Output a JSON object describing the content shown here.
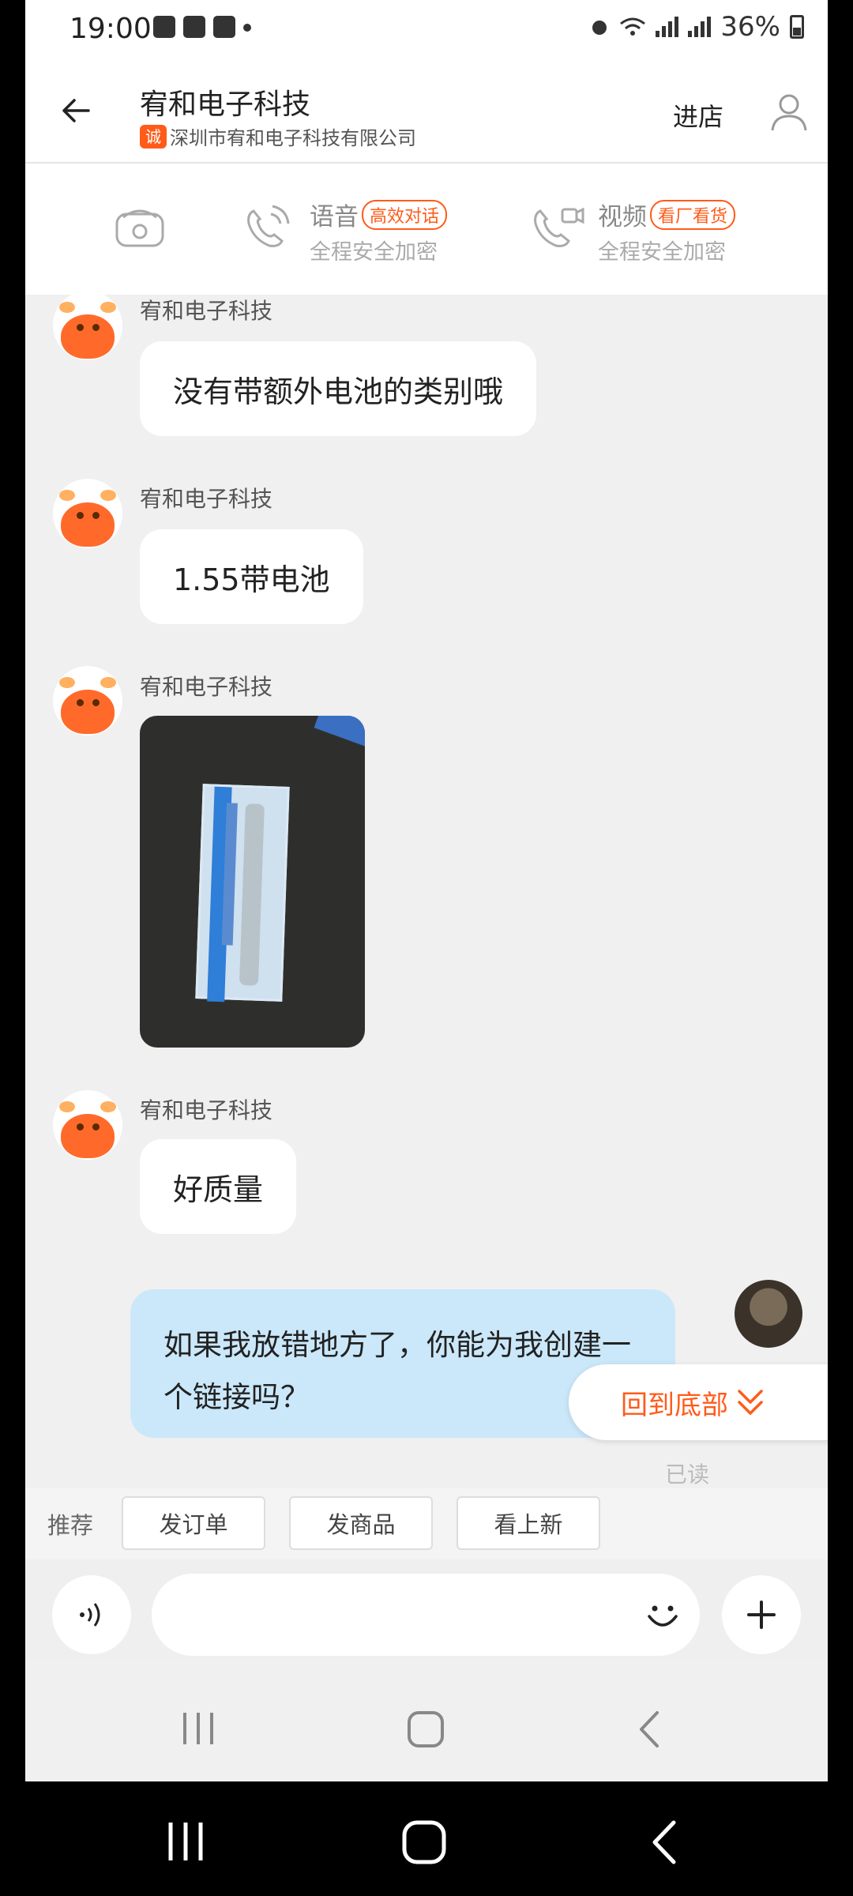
{
  "status_bar": {
    "time": "19:00",
    "battery": "36%"
  },
  "header": {
    "shop_name": "宥和电子科技",
    "company_badge": "诚",
    "company": "深圳市宥和电子科技有限公司",
    "enter_shop": "进店"
  },
  "call_bar": {
    "voice": {
      "title": "语音",
      "badge": "高效对话",
      "sub": "全程安全加密"
    },
    "video": {
      "title": "视频",
      "badge": "看厂看货",
      "sub": "全程安全加密"
    }
  },
  "messages": [
    {
      "sender": "宥和电子科技",
      "text": "没有带额外电池的类别哦"
    },
    {
      "sender": "宥和电子科技",
      "text": "1.55带电池"
    },
    {
      "sender": "宥和电子科技",
      "type": "image"
    },
    {
      "sender": "宥和电子科技",
      "text": "好质量"
    }
  ],
  "my_message": {
    "text": "如果我放错地方了，你能为我创建一个链接吗？",
    "status": "已读"
  },
  "scroll_to_bottom": "回到底部",
  "quick_bar": {
    "label": "推荐",
    "buttons": [
      "发订单",
      "发商品",
      "看上新"
    ]
  },
  "input": {
    "placeholder": ""
  },
  "colors": {
    "accent": "#ff5b1a",
    "my_bubble": "#cbe8fa",
    "background": "#f0f0f0"
  }
}
